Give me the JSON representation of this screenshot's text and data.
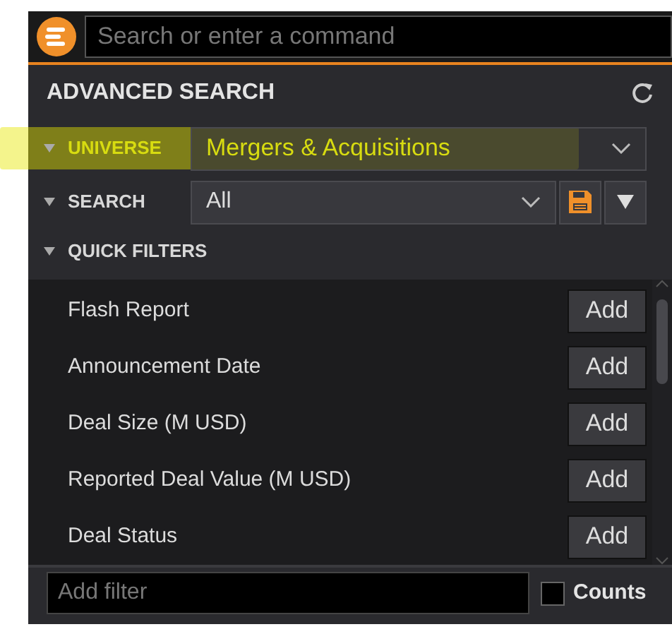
{
  "command_bar": {
    "placeholder": "Search or enter a command"
  },
  "panel": {
    "title": "ADVANCED SEARCH"
  },
  "universe": {
    "label": "UNIVERSE",
    "value": "Mergers & Acquisitions",
    "highlighted": true
  },
  "search": {
    "label": "SEARCH",
    "value": "All"
  },
  "quick_filters": {
    "label": "QUICK FILTERS",
    "items": [
      {
        "label": "Flash Report",
        "button": "Add"
      },
      {
        "label": "Announcement Date",
        "button": "Add"
      },
      {
        "label": "Deal Size (M USD)",
        "button": "Add"
      },
      {
        "label": "Reported Deal Value (M USD)",
        "button": "Add"
      },
      {
        "label": "Deal Status",
        "button": "Add"
      }
    ]
  },
  "footer": {
    "placeholder": "Add filter",
    "counts": {
      "label": "Counts",
      "checked": false
    }
  }
}
